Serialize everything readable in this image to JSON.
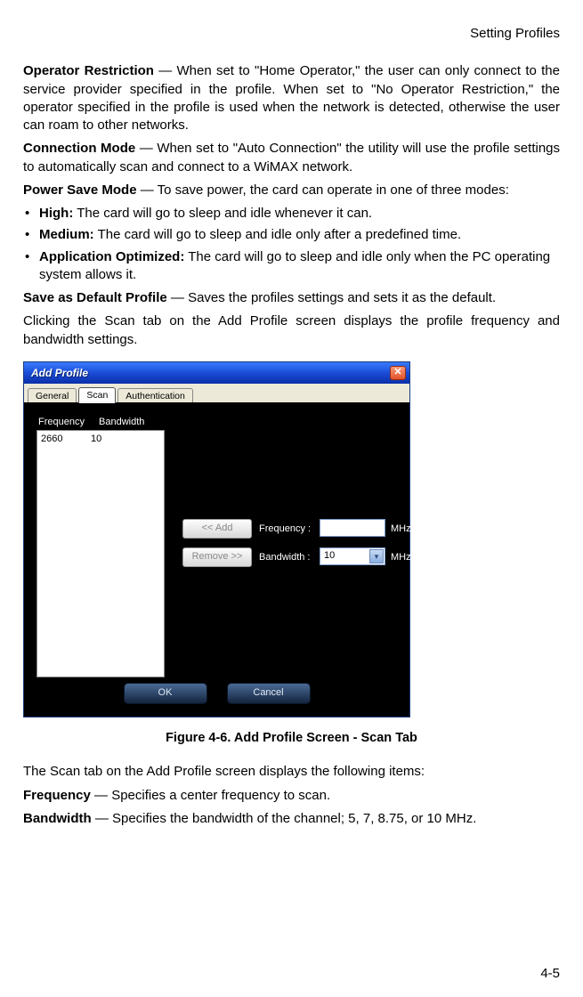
{
  "header": {
    "section_title": "Setting Profiles"
  },
  "body": {
    "op_restriction": {
      "term": "Operator Restriction",
      "text": " — When set to \"Home Operator,\" the user can only connect to the service provider specified in the profile. When set to \"No Operator Restriction,\" the operator specified in the profile is used when the network is detected, otherwise the user can roam to other networks."
    },
    "conn_mode": {
      "term": "Connection Mode",
      "text": " — When set to \"Auto Connection\" the utility will use the profile settings to automatically scan and connect to a WiMAX network."
    },
    "power_save": {
      "term": "Power Save Mode",
      "text": " — To save power, the card can operate in one of three modes:"
    },
    "modes": [
      {
        "term": "High:",
        "text": " The card will go to sleep and idle whenever it can."
      },
      {
        "term": "Medium:",
        "text": " The card will go to sleep and idle only after a predefined time."
      },
      {
        "term": "Application Optimized:",
        "text": " The card will go to sleep and idle only when the PC operating system allows it."
      }
    ],
    "save_default": {
      "term": "Save as Default Profile",
      "text": " — Saves the profiles settings and sets it as the default."
    },
    "scan_intro": "Clicking the Scan tab on the Add Profile screen displays the profile frequency and bandwidth settings.",
    "figure_caption": "Figure 4-6.  Add Profile Screen - Scan Tab",
    "scan_desc": "The Scan tab on the Add Profile screen displays the following items:",
    "frequency": {
      "term": "Frequency",
      "text": " — Specifies a center frequency to scan."
    },
    "bandwidth": {
      "term": "Bandwidth",
      "text": " — Specifies the bandwidth of the channel; 5, 7, 8.75, or 10 MHz."
    }
  },
  "window": {
    "title": "Add Profile",
    "tabs": [
      "General",
      "Scan",
      "Authentication"
    ],
    "active_tab": 1,
    "list": {
      "headers": [
        "Frequency",
        "Bandwidth"
      ],
      "rows": [
        [
          "2660",
          "10"
        ]
      ]
    },
    "buttons": {
      "add": "<< Add",
      "remove": "Remove >>"
    },
    "fields": {
      "frequency": {
        "label": "Frequency :",
        "value": "",
        "unit": "MHz"
      },
      "bandwidth": {
        "label": "Bandwidth :",
        "value": "10",
        "unit": "MHz"
      }
    },
    "actions": {
      "ok": "OK",
      "cancel": "Cancel"
    }
  },
  "page_number": "4-5"
}
